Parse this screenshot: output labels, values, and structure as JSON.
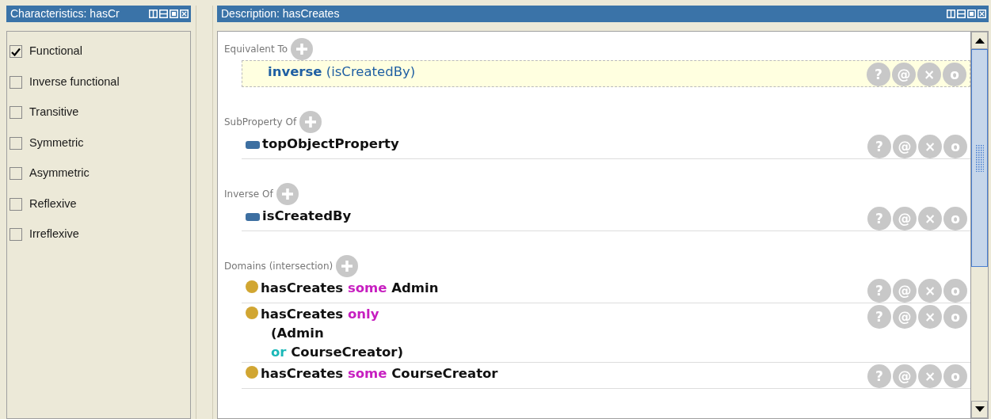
{
  "characteristics": {
    "title": "Characteristics: hasCr",
    "items": [
      {
        "label": "Functional",
        "checked": true
      },
      {
        "label": "Inverse functional",
        "checked": false
      },
      {
        "label": "Transitive",
        "checked": false
      },
      {
        "label": "Symmetric",
        "checked": false
      },
      {
        "label": "Asymmetric",
        "checked": false
      },
      {
        "label": "Reflexive",
        "checked": false
      },
      {
        "label": "Irreflexive",
        "checked": false
      }
    ]
  },
  "description": {
    "title": "Description: hasCreates",
    "sections": [
      {
        "label": "Equivalent To",
        "items": [
          {
            "kind": "expression",
            "selected": true,
            "lines": [
              [
                {
                  "text": "inverse",
                  "kind": "keyword"
                },
                {
                  "text": " (isCreatedBy)",
                  "kind": "plain"
                }
              ]
            ],
            "buttons": [
              "?",
              "@",
              "×",
              "o"
            ]
          }
        ]
      },
      {
        "label": "SubProperty Of",
        "items": [
          {
            "kind": "property",
            "selected": false,
            "lines": [
              [
                {
                  "text": "topObjectProperty",
                  "kind": "entity"
                }
              ]
            ],
            "buttons": [
              "?",
              "@",
              "×",
              "o"
            ]
          }
        ]
      },
      {
        "label": "Inverse Of",
        "items": [
          {
            "kind": "property",
            "selected": false,
            "lines": [
              [
                {
                  "text": "isCreatedBy",
                  "kind": "entity"
                }
              ]
            ],
            "buttons": [
              "?",
              "@",
              "×",
              "o"
            ]
          }
        ]
      },
      {
        "label": "Domains (intersection)",
        "items": [
          {
            "kind": "class",
            "selected": false,
            "lines": [
              [
                {
                  "text": "hasCreates",
                  "kind": "entity"
                },
                {
                  "text": " some",
                  "kind": "quantifier"
                },
                {
                  "text": " Admin",
                  "kind": "entity"
                }
              ]
            ],
            "buttons": [
              "?",
              "@",
              "×",
              "o"
            ]
          },
          {
            "kind": "class",
            "selected": false,
            "lines": [
              [
                {
                  "text": "hasCreates",
                  "kind": "entity"
                },
                {
                  "text": " only",
                  "kind": "quantifier"
                }
              ],
              [
                {
                  "text": "(Admin",
                  "kind": "entity"
                }
              ],
              [
                {
                  "text": " or",
                  "kind": "connective"
                },
                {
                  "text": " CourseCreator)",
                  "kind": "entity"
                }
              ]
            ],
            "buttons": [
              "?",
              "@",
              "×",
              "o"
            ]
          },
          {
            "kind": "class",
            "selected": false,
            "lines": [
              [
                {
                  "text": "hasCreates",
                  "kind": "entity"
                },
                {
                  "text": " some",
                  "kind": "quantifier"
                },
                {
                  "text": " CourseCreator",
                  "kind": "entity"
                }
              ]
            ],
            "buttons": [
              "?",
              "@",
              "×",
              "o"
            ]
          }
        ]
      }
    ]
  }
}
